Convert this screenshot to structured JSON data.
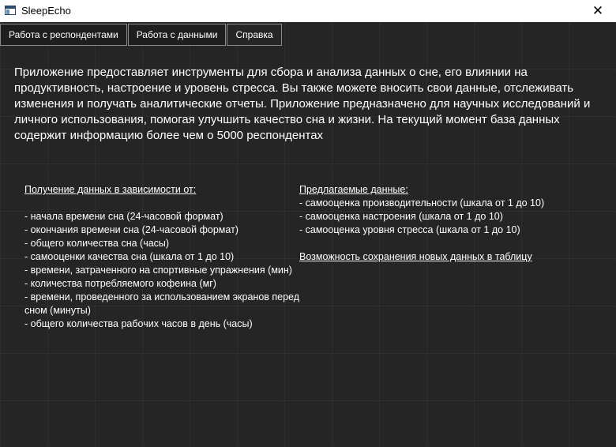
{
  "window": {
    "title": "SleepEcho",
    "close_glyph": "✕",
    "icon": "app-window-icon"
  },
  "tabs": [
    {
      "label": "Работа с респондентами"
    },
    {
      "label": "Работа с данными"
    },
    {
      "label": "Справка"
    }
  ],
  "intro": "Приложение предоставляет инструменты для сбора и анализа данных о сне, его влиянии на продуктивность, настроение и уровень стресса. Вы также можете вносить свои данные, отслеживать изменения и получать аналитические отчеты. Приложение предназначено для научных исследований и личного использования, помогая улучшить качество сна и жизни. На текущий момент база данных содержит информацию более чем о 5000 респондентах",
  "left": {
    "heading": "Получение данных в зависимости от:",
    "items": [
      " - начала времени сна (24-часовой формат)",
      " - окончания времени сна (24-часовой формат)",
      " - общего количества сна (часы)",
      " - самооценки качества сна (шкала от 1 до 10)",
      " - времени, затраченного на спортивные упражнения (мин)",
      " - количества потребляемого кофеина (мг)",
      " - времени, проведенного за использованием экранов перед сном (минуты)",
      " - общего количества рабочих часов в день (часы)"
    ]
  },
  "right": {
    "heading": "Предлагаемые данные:",
    "items": [
      " - самооценка производительности (шкала от 1 до 10)",
      " - самооценка настроения (шкала от 1 до 10)",
      " - самооценка уровня стресса (шкала от 1 до 10)"
    ],
    "heading2": "Возможность сохранения новых данных в таблицу"
  }
}
